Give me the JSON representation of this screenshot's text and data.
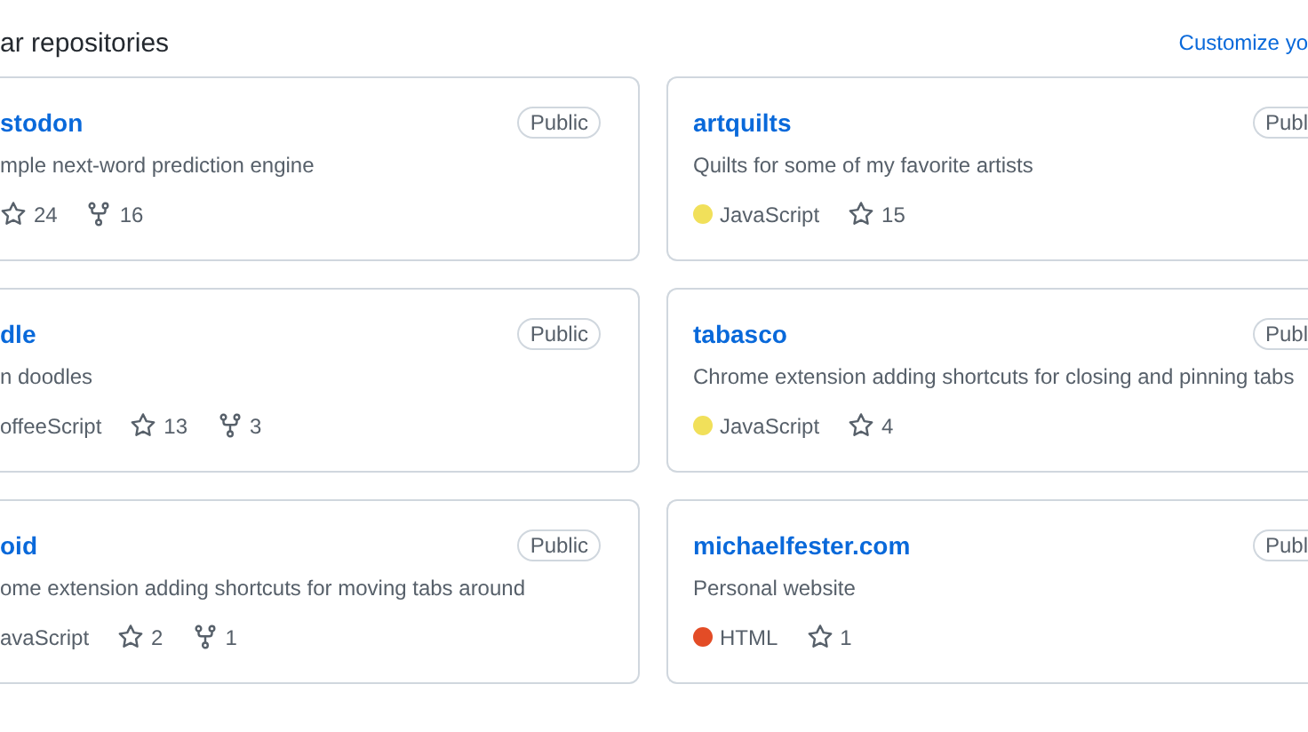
{
  "header": {
    "title": "ar repositories",
    "link": "Customize yo"
  },
  "columns": [
    {
      "kind": "left",
      "repos": [
        {
          "name": "stodon",
          "badge": "Public",
          "description": "mple next-word prediction engine",
          "stats": [
            {
              "kind": "stars",
              "text": "24"
            },
            {
              "kind": "forks",
              "text": "16"
            }
          ]
        },
        {
          "name": "dle",
          "badge": "Public",
          "description": "n doodles",
          "stats": [
            {
              "kind": "language",
              "text": "offeeScript"
            },
            {
              "kind": "stars",
              "text": "13"
            },
            {
              "kind": "forks",
              "text": "3"
            }
          ]
        },
        {
          "name": "oid",
          "badge": "Public",
          "description": "ome extension adding shortcuts for moving tabs around",
          "stats": [
            {
              "kind": "language",
              "text": "avaScript"
            },
            {
              "kind": "stars",
              "text": "2"
            },
            {
              "kind": "forks",
              "text": "1"
            }
          ]
        }
      ]
    },
    {
      "kind": "right",
      "repos": [
        {
          "name": "artquilts",
          "badge": "Publ",
          "description": "Quilts for some of my favorite artists",
          "stats": [
            {
              "kind": "language",
              "text": "JavaScript",
              "color": "#f1e05a"
            },
            {
              "kind": "stars",
              "text": "15"
            }
          ]
        },
        {
          "name": "tabasco",
          "badge": "Publ",
          "description": "Chrome extension adding shortcuts for closing and pinning tabs",
          "stats": [
            {
              "kind": "language",
              "text": "JavaScript",
              "color": "#f1e05a"
            },
            {
              "kind": "stars",
              "text": "4"
            }
          ]
        },
        {
          "name": "michaelfester.com",
          "badge": "Publ",
          "description": "Personal website",
          "stats": [
            {
              "kind": "language",
              "text": "HTML",
              "color": "#e34c26"
            },
            {
              "kind": "stars",
              "text": "1"
            }
          ]
        }
      ]
    }
  ]
}
